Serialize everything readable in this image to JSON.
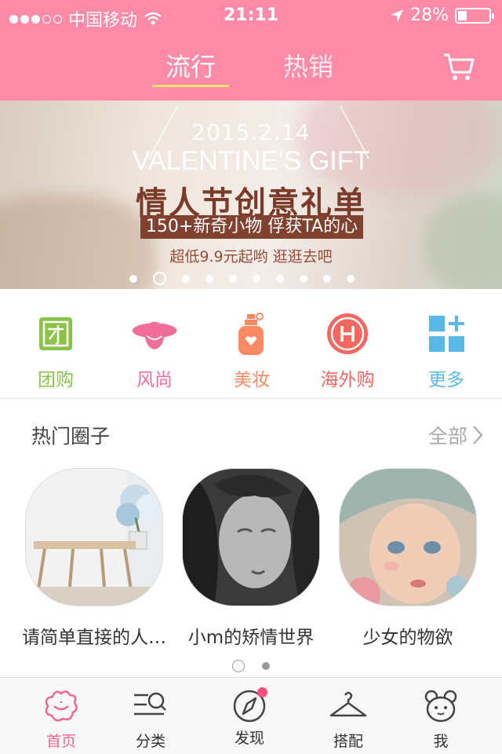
{
  "status": {
    "carrier": "中国移动",
    "time": "21:11",
    "battery_text": "28%",
    "battery_level": 0.28,
    "signal_filled": 3,
    "signal_total": 5
  },
  "header": {
    "tabs": [
      {
        "label": "流行",
        "active": true
      },
      {
        "label": "热销",
        "active": false
      }
    ],
    "cart_icon": "cart-icon"
  },
  "banner": {
    "date": "2015.2.14",
    "english": "VALENTINE'S GIFT",
    "title": "情人节创意礼单",
    "subtitle": "150+新奇小物 俘获TA的心",
    "promo": "超低9.9元起哟 逛逛去吧",
    "page_count": 10,
    "current_page": 2
  },
  "categories": [
    {
      "label": "团购",
      "icon": "group-buy-icon",
      "color": "#8bc34a"
    },
    {
      "label": "风尚",
      "icon": "fashion-hat-icon",
      "color": "#f06f9a"
    },
    {
      "label": "美妆",
      "icon": "perfume-icon",
      "color": "#fa8a63"
    },
    {
      "label": "海外购",
      "icon": "overseas-h-icon",
      "color": "#f3675f"
    },
    {
      "label": "更多",
      "icon": "more-grid-icon",
      "color": "#5ab8e6"
    }
  ],
  "hot_circles": {
    "title": "热门圈子",
    "all_label": "全部",
    "items": [
      {
        "label": "请简单直接的人…"
      },
      {
        "label": "小m的矫情世界"
      },
      {
        "label": "少女的物欲"
      }
    ],
    "page_count": 2,
    "current_page": 1
  },
  "tabbar": {
    "items": [
      {
        "label": "首页",
        "icon": "home-flower-icon",
        "active": true
      },
      {
        "label": "分类",
        "icon": "category-search-icon",
        "active": false
      },
      {
        "label": "发现",
        "icon": "compass-icon",
        "active": false,
        "badge": true
      },
      {
        "label": "搭配",
        "icon": "hanger-icon",
        "active": false
      },
      {
        "label": "我",
        "icon": "profile-bear-icon",
        "active": false
      }
    ]
  },
  "colors": {
    "brand_pink": "#fd8ba8",
    "tab_underline": "#ffe46b",
    "active_tab": "#f0668e"
  }
}
